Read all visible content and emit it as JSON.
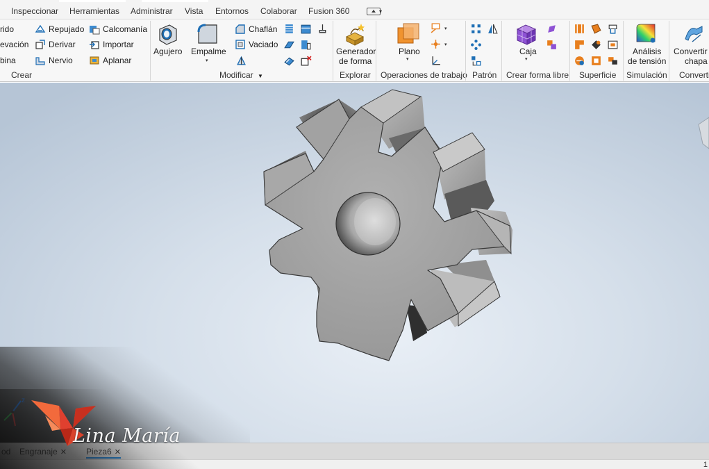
{
  "menu": {
    "items": [
      "Inspeccionar",
      "Herramientas",
      "Administrar",
      "Vista",
      "Entornos",
      "Colaborar",
      "Fusion 360"
    ]
  },
  "ribbon": {
    "crear": {
      "col1": [
        "rido",
        "evación",
        "bina"
      ],
      "col2": [
        "Repujado",
        "Derivar",
        "Nervio"
      ],
      "col3": [
        "Calcomanía",
        "Importar",
        "Aplanar"
      ],
      "title": "Crear"
    },
    "modificar": {
      "agujero": "Agujero",
      "empalme": "Empalme",
      "chaflan": "Chaflán",
      "vaciado": "Vaciado",
      "title": "Modificar"
    },
    "explorar": {
      "generador_1": "Generador",
      "generador_2": "de forma",
      "title": "Explorar"
    },
    "operaciones": {
      "plano": "Plano",
      "title": "Operaciones de trabajo"
    },
    "patron": {
      "title": "Patrón"
    },
    "forma_libre": {
      "caja": "Caja",
      "title": "Crear forma libre"
    },
    "superficie": {
      "title": "Superficie"
    },
    "simulacion": {
      "analisis_1": "Análisis",
      "analisis_2": "de tensión",
      "title": "Simulación"
    },
    "convertir": {
      "convertir_1": "Convertir",
      "convertir_2": "chapa",
      "title": "Converti"
    }
  },
  "doc_tabs": {
    "tabs": [
      "od",
      "Engranaje"
    ],
    "active": "Pieza6"
  },
  "status": {
    "page_count": "1"
  },
  "watermark": {
    "text": "Lina María"
  },
  "colors": {
    "accent": "#1a7fd4",
    "gear_face": "#9e9e9e",
    "watermark_red": "#e0402f"
  },
  "icons": {
    "view_switch": "view-cube-icon",
    "gear_model": "gear-3d-model",
    "coordinate_axes": "axes-triad-icon"
  }
}
